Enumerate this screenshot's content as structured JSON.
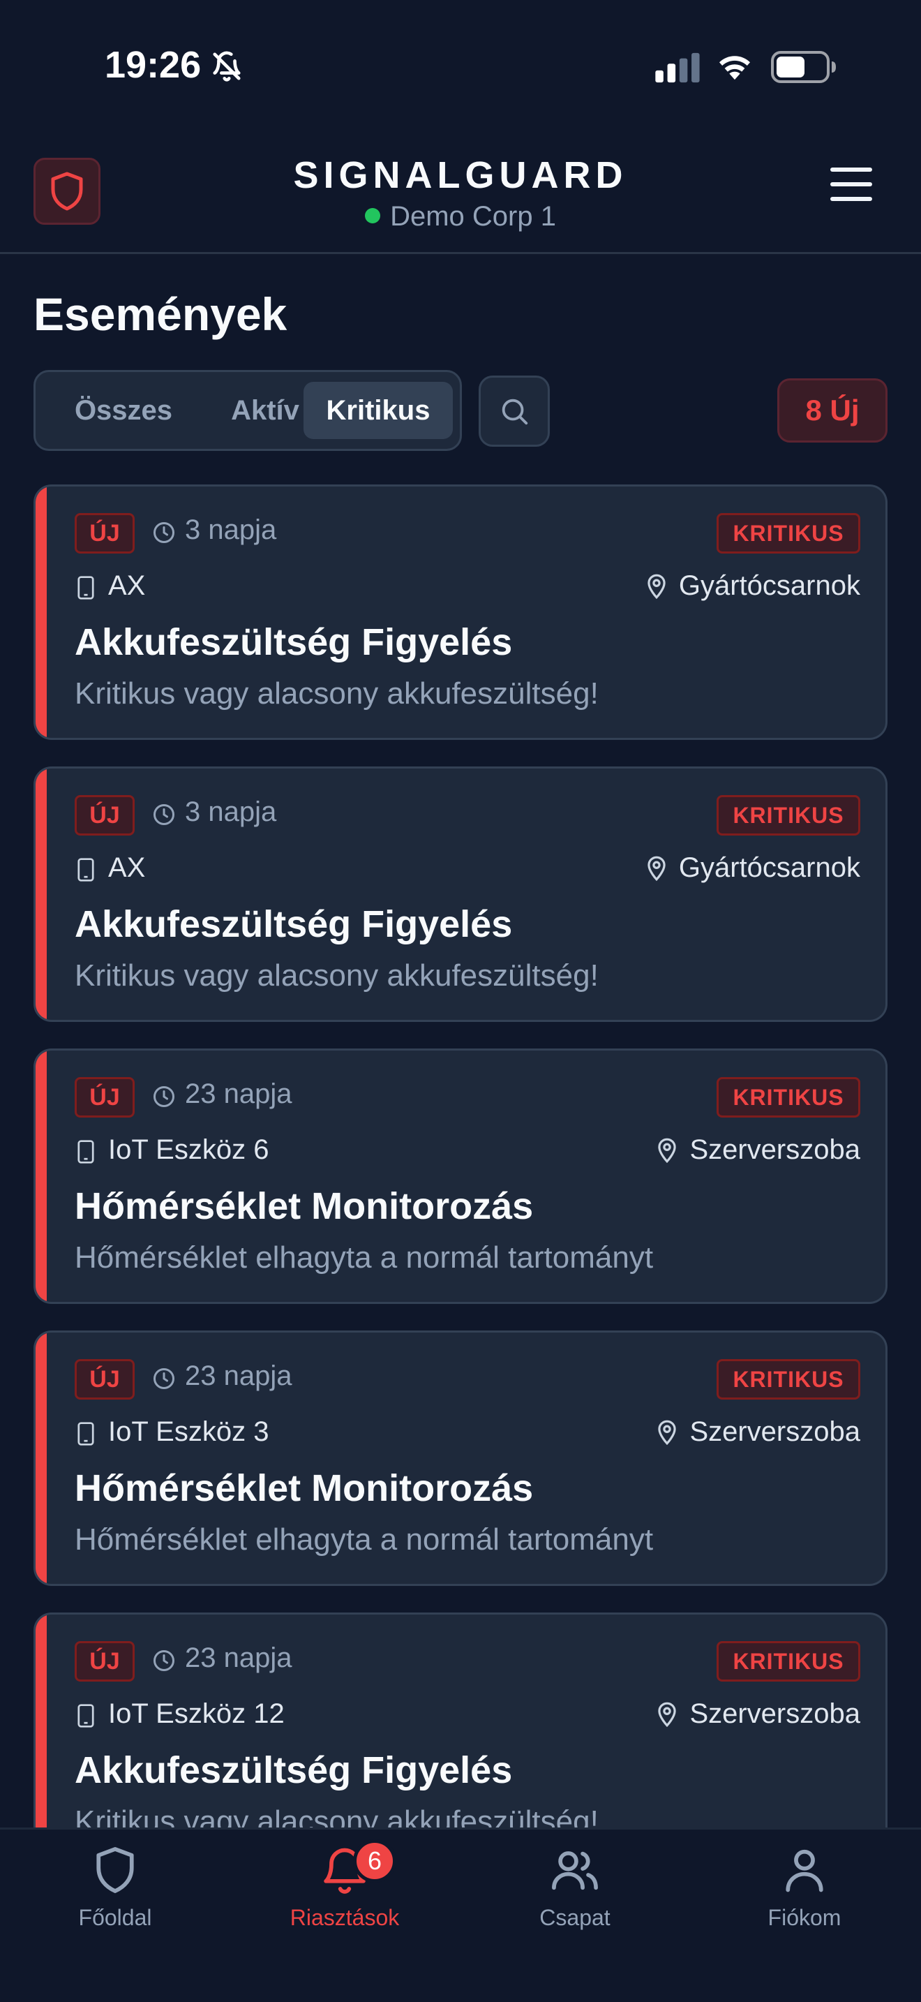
{
  "status_bar": {
    "time": "19:26",
    "icons": [
      "bell-slash-icon",
      "cellular-signal-icon",
      "wifi-icon",
      "battery-icon"
    ]
  },
  "header": {
    "title": "SIGNALGUARD",
    "organization": "Demo Corp 1",
    "organization_status_color": "#22c55e",
    "logo_icon": "shield-icon",
    "menu_icon": "hamburger-menu-icon"
  },
  "page": {
    "title": "Események"
  },
  "filters": {
    "tabs": [
      {
        "label": "Összes",
        "active": false
      },
      {
        "label": "Aktív",
        "active": false
      },
      {
        "label": "Kritikus",
        "active": true
      }
    ],
    "search_icon": "search-icon",
    "new_count_label": "8 Új"
  },
  "events": [
    {
      "new_label": "ÚJ",
      "time": "3 napja",
      "severity": "KRITIKUS",
      "device": "AX",
      "location": "Gyártócsarnok",
      "title": "Akkufeszültség Figyelés",
      "description": "Kritikus vagy alacsony akkufeszültség!"
    },
    {
      "new_label": "ÚJ",
      "time": "3 napja",
      "severity": "KRITIKUS",
      "device": "AX",
      "location": "Gyártócsarnok",
      "title": "Akkufeszültség Figyelés",
      "description": "Kritikus vagy alacsony akkufeszültség!"
    },
    {
      "new_label": "ÚJ",
      "time": "23 napja",
      "severity": "KRITIKUS",
      "device": "IoT Eszköz 6",
      "location": "Szerverszoba",
      "title": "Hőmérséklet Monitorozás",
      "description": "Hőmérséklet elhagyta a normál tartományt"
    },
    {
      "new_label": "ÚJ",
      "time": "23 napja",
      "severity": "KRITIKUS",
      "device": "IoT Eszköz 3",
      "location": "Szerverszoba",
      "title": "Hőmérséklet Monitorozás",
      "description": "Hőmérséklet elhagyta a normál tartományt"
    },
    {
      "new_label": "ÚJ",
      "time": "23 napja",
      "severity": "KRITIKUS",
      "device": "IoT Eszköz 12",
      "location": "Szerverszoba",
      "title": "Akkufeszültség Figyelés",
      "description": "Kritikus vagy alacsony akkufeszültség!"
    }
  ],
  "colors": {
    "background": "#0f172a",
    "card": "#1e293b",
    "accent_critical": "#ef4444",
    "muted_text": "#94a3b8"
  },
  "bottom_nav": {
    "items": [
      {
        "label": "Főoldal",
        "icon": "shield-icon",
        "active": false
      },
      {
        "label": "Riasztások",
        "icon": "bell-icon",
        "active": true,
        "badge": "6"
      },
      {
        "label": "Csapat",
        "icon": "users-icon",
        "active": false
      },
      {
        "label": "Fiókom",
        "icon": "user-icon",
        "active": false
      }
    ]
  }
}
